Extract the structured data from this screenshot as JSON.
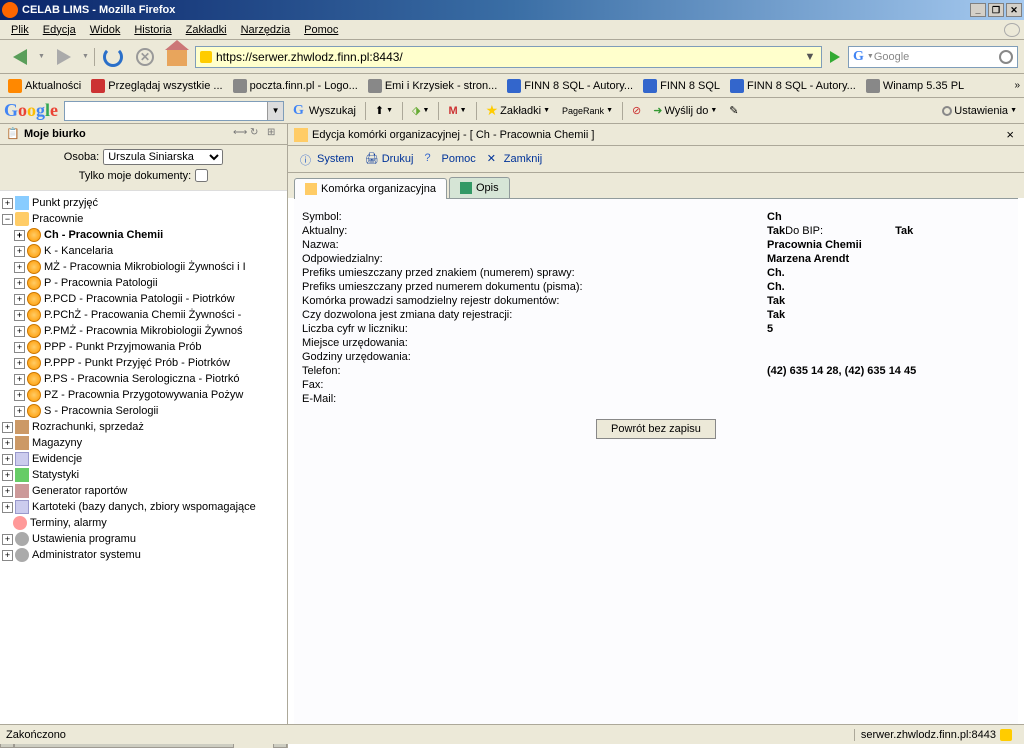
{
  "window": {
    "title": "CELAB LIMS - Mozilla Firefox"
  },
  "menu": {
    "file": "Plik",
    "edit": "Edycja",
    "view": "Widok",
    "history": "Historia",
    "bookmarks": "Zakładki",
    "tools": "Narzędzia",
    "help": "Pomoc"
  },
  "url": "https://serwer.zhwlodz.finn.pl:8443/",
  "search_placeholder": "Google",
  "bookmarks": [
    "Aktualności",
    "Przeglądaj wszystkie ...",
    "poczta.finn.pl - Logo...",
    "Emi i Krzysiek - stron...",
    "FINN 8 SQL - Autory...",
    "FINN 8 SQL",
    "FINN 8 SQL - Autory...",
    "Winamp 5.35 PL"
  ],
  "gtb": {
    "search": "Wyszukaj",
    "bookmarks": "Zakładki",
    "pagerank": "PageRank",
    "send": "Wyślij do",
    "settings": "Ustawienia"
  },
  "left": {
    "title": "Moje biurko",
    "person_label": "Osoba:",
    "person": "Urszula Siniarska",
    "mydocs": "Tylko moje dokumenty:"
  },
  "tree": {
    "n1": "Punkt przyjęć",
    "n2": "Pracownie",
    "c1": "Ch - Pracownia Chemii",
    "c2": "K - Kancelaria",
    "c3": "MŻ - Pracownia Mikrobiologii Żywności i I",
    "c4": "P - Pracownia Patologii",
    "c5": "P.PCD - Pracownia Patologii - Piotrków",
    "c6": "P.PChŻ - Pracowania Chemii Żywności -",
    "c7": "P.PMŻ - Pracownia Mikrobiologii Żywnoś",
    "c8": "PPP - Punkt Przyjmowania Prób",
    "c9": "P.PPP - Punkt Przyjęć Prób - Piotrków",
    "c10": "P.PS - Pracownia Serologiczna - Piotrkó",
    "c11": "PZ - Pracownia Przygotowywania Pożyw",
    "c12": "S - Pracownia Serologii",
    "n3": "Rozrachunki, sprzedaż",
    "n4": "Magazyny",
    "n5": "Ewidencje",
    "n6": "Statystyki",
    "n7": "Generator raportów",
    "n8": "Kartoteki (bazy danych, zbiory wspomagające",
    "n9": "Terminy, alarmy",
    "n10": "Ustawienia programu",
    "n11": "Administrator systemu"
  },
  "right": {
    "title": "Edycja komórki organizacyjnej - [ Ch - Pracownia Chemii ]",
    "tb": {
      "system": "System",
      "print": "Drukuj",
      "help": "Pomoc",
      "close": "Zamknij"
    },
    "tabs": {
      "t1": "Komórka organizacyjna",
      "t2": "Opis"
    },
    "labels": {
      "symbol": "Symbol:",
      "aktualny": "Aktualny:",
      "dobip": "Do BIP:",
      "nazwa": "Nazwa:",
      "odpow": "Odpowiedzialny:",
      "prefix1": "Prefiks umieszczany przed znakiem (numerem) sprawy:",
      "prefix2": "Prefiks umieszczany przed numerem dokumentu (pisma):",
      "samodz": "Komórka prowadzi samodzielny rejestr dokumentów:",
      "zmiana": "Czy dozwolona jest zmiana daty rejestracji:",
      "cyfry": "Liczba cyfr w liczniku:",
      "miejsce": "Miejsce urzędowania:",
      "godziny": "Godziny urzędowania:",
      "telefon": "Telefon:",
      "fax": "Fax:",
      "email": "E-Mail:"
    },
    "values": {
      "symbol": "Ch",
      "aktualny": "Tak",
      "dobip": "Tak",
      "nazwa": "Pracownia Chemii",
      "odpow": "Marzena Arendt",
      "prefix1": "Ch.",
      "prefix2": "Ch.",
      "samodz": "Tak",
      "zmiana": "Tak",
      "cyfry": "5",
      "telefon": "(42) 635 14 28, (42) 635 14 45"
    },
    "return": "Powrót bez zapisu"
  },
  "status": {
    "left": "Zakończono",
    "right": "serwer.zhwlodz.finn.pl:8443"
  }
}
